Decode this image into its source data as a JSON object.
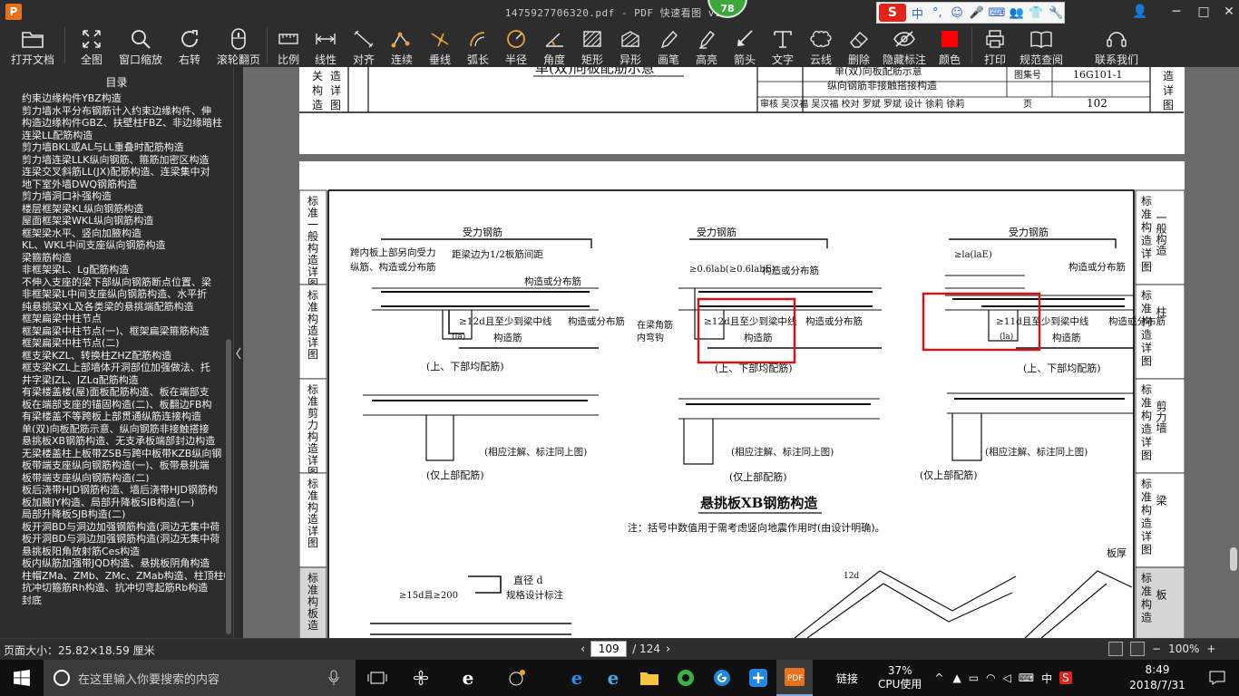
{
  "window": {
    "title": "1475927706320.pdf - PDF 快速看图 v1.9",
    "app_logo": "P",
    "badge": "78",
    "ime": {
      "logo": "S",
      "items": [
        "中",
        "°,",
        "☺",
        "🎤",
        "⌨",
        "👥",
        "👕",
        "🔧"
      ]
    },
    "controls": [
      "👤",
      "─",
      "□",
      "✕"
    ]
  },
  "toolbar": {
    "items": [
      {
        "name": "open-file",
        "label": "打开文档",
        "icon": "folder-icon"
      },
      {
        "name": "fit-all",
        "label": "全图",
        "icon": "expand-icon"
      },
      {
        "name": "window-zoom",
        "label": "窗口缩放",
        "icon": "magnifier-icon"
      },
      {
        "name": "rotate-right",
        "label": "右转",
        "icon": "rotate-icon"
      },
      {
        "name": "wheel-page",
        "label": "滚轮翻页",
        "icon": "mouse-icon"
      },
      {
        "name": "scale",
        "label": "比例",
        "icon": "ruler-icon"
      },
      {
        "name": "linear",
        "label": "线性",
        "icon": "dimension-icon"
      },
      {
        "name": "aligned",
        "label": "对齐",
        "icon": "aligned-dim-icon"
      },
      {
        "name": "continuous",
        "label": "连续",
        "icon": "polyline-icon"
      },
      {
        "name": "perpendicular",
        "label": "垂线",
        "icon": "perpendicular-icon"
      },
      {
        "name": "arc-length",
        "label": "弧长",
        "icon": "arc-icon"
      },
      {
        "name": "radius",
        "label": "半径",
        "icon": "radius-icon"
      },
      {
        "name": "angle",
        "label": "角度",
        "icon": "angle-icon"
      },
      {
        "name": "rectangle",
        "label": "矩形",
        "icon": "rect-hatch-icon"
      },
      {
        "name": "irregular",
        "label": "异形",
        "icon": "shape-hatch-icon"
      },
      {
        "name": "pen",
        "label": "画笔",
        "icon": "pen-icon"
      },
      {
        "name": "highlighter",
        "label": "高亮",
        "icon": "highlighter-icon"
      },
      {
        "name": "arrow",
        "label": "箭头",
        "icon": "arrow-icon"
      },
      {
        "name": "text",
        "label": "文字",
        "icon": "text-icon"
      },
      {
        "name": "cloud",
        "label": "云线",
        "icon": "cloud-icon"
      },
      {
        "name": "delete",
        "label": "删除",
        "icon": "eraser-icon"
      },
      {
        "name": "hide-marks",
        "label": "隐藏标注",
        "icon": "eye-hide-icon"
      },
      {
        "name": "color",
        "label": "颜色",
        "icon": "color-swatch-icon"
      },
      {
        "name": "print",
        "label": "打印",
        "icon": "printer-icon"
      },
      {
        "name": "code-lookup",
        "label": "规范查阅",
        "icon": "book-icon"
      },
      {
        "name": "contact",
        "label": "联系我们",
        "icon": "contact-icon"
      }
    ],
    "accent": "#e8a33a",
    "color_swatch": "#ff0000"
  },
  "sidebar": {
    "title": "目录",
    "items": [
      "约束边缘构件YBZ构造",
      "剪力墙水平分布钢筋计入约束边缘构件、伸",
      "构造边缘构件GBZ、扶壁柱FBZ、非边缘暗柱",
      "连梁LL配筋构造",
      "剪力墙BKL或AL与LL重叠时配筋构造",
      "剪力墙连梁LLK纵向钢筋、箍筋加密区构造",
      "连梁交叉斜筋LL(JX)配筋构造、连梁集中对",
      "地下室外墙DWQ钢筋构造",
      "剪力墙洞口补强构造",
      "楼层框架梁KL纵向钢筋构造",
      "屋面框架梁WKL纵向钢筋构造",
      "框架梁水平、竖向加腋构造",
      "KL、WKL中间支座纵向钢筋构造",
      "梁箍筋构造",
      "非框架梁L、Lg配筋构造",
      "不伸入支座的梁下部纵向钢筋断点位置、梁",
      "非框架梁L中间支座纵向钢筋构造、水平折",
      "纯悬挑梁XL及各类梁的悬挑端配筋构造",
      "框架扁梁中柱节点",
      "框架扁梁中柱节点(一)、框架扁梁箍筋构造",
      "框架扁梁中柱节点(二)",
      "框支梁KZL、转换柱ZHZ配筋构造",
      "框支梁KZL上部墙体开洞部位加强做法、托",
      "井字梁JZL、JZLg配筋构造",
      "有梁楼盖楼(屋)面板配筋构造、板在端部支",
      "板在端部支座的锚固构造(二)、板翻边FB构",
      "有梁楼盖不等跨板上部贯通纵筋连接构造",
      "单(双)向板配筋示意、纵向钢筋非接触搭接",
      "悬挑板XB钢筋构造、无支承板端部封边构造",
      "无梁楼盖柱上板带ZSB与跨中板带KZB纵向钢",
      "板带端支座纵向钢筋构造(一)、板带悬挑端",
      "板带端支座纵向钢筋构造(二)",
      "板后浇带HJD钢筋构造、墙后浇带HJD钢筋构",
      "板加腋JY构造、局部升降板SJB构造(一)",
      "局部升降板SJB构造(二)",
      "板开洞BD与洞边加强钢筋构造(洞边无集中荷",
      "板开洞BD与洞边加强钢筋构造(洞边无集中荷",
      "悬挑板阳角放射筋Ces构造",
      "板内纵筋加强带JQD构造、悬挑板阴角构造",
      "柱帽ZMa、ZMb、ZMc、ZMab构造、柱顶柱帽",
      "抗冲切箍筋Rh构造、抗冲切弯起筋Rb构造",
      "封底"
    ]
  },
  "document": {
    "top_page": {
      "left_tab": [
        "关",
        "构",
        "造"
      ],
      "left_tab2": [
        "造",
        "详",
        "图"
      ],
      "title": "单(双)向板配筋示意",
      "header_title": "单(双)向板配筋示意",
      "header_subtitle": "纵向钢筋非接触搭接构造",
      "atlas_label": "图集号",
      "atlas_no": "16G101-1",
      "page_label": "页",
      "page_no": "102",
      "review_row": "审核 吴汉福 吴汉福 校对 罗斌 罗斌 设计 徐莉 徐莉",
      "right_tab": [
        "造",
        "详",
        "图"
      ]
    },
    "main_page": {
      "left_tabs": [
        [
          "标",
          "准",
          "一",
          "般",
          "构",
          "造",
          "详",
          "图"
        ],
        [
          "标",
          "准",
          "构",
          "造",
          "详",
          "图"
        ],
        [
          "标",
          "准",
          "剪",
          "力",
          "构",
          "造",
          "详",
          "图"
        ],
        [
          "标",
          "准",
          "构",
          "造",
          "详",
          "图"
        ],
        [
          "标",
          "准",
          "构",
          "板",
          "造"
        ]
      ],
      "right_tabs": [
        {
          "text": [
            "标",
            "准",
            "构",
            "造",
            "详",
            "图"
          ],
          "side": "一般构造"
        },
        {
          "text": [
            "标",
            "准",
            "构",
            "造",
            "详",
            "图"
          ],
          "side": "柱"
        },
        {
          "text": [
            "标",
            "准",
            "构",
            "造",
            "详",
            "图"
          ],
          "side": "剪力墙"
        },
        {
          "text": [
            "标",
            "准",
            "构",
            "造",
            "详",
            "图"
          ],
          "side": "梁"
        },
        {
          "text": [
            "标",
            "准",
            "构",
            "造"
          ],
          "side": "板"
        }
      ],
      "labels": {
        "stressed_bar": "受力钢筋",
        "note_span": "跨内板上部另向受力",
        "note_span2": "纵筋、构造或分布筋",
        "half_spacing": "距梁边为1/2板筋间距",
        "dist_bar": "构造或分布筋",
        "anchor_12d": "≥12d且至少到梁中线",
        "la": "(la)",
        "construct_bar": "构造筋",
        "dist_bar2": "构造或分布筋",
        "both_bars": "(上、下部均配筋)",
        "dim_06": "≥0.6lab(≥0.6labE)",
        "corner": "在梁角筋",
        "inner_hook": "内弯钩",
        "dim_la": "≥la(laE)",
        "anchor_11d": "≥11d且至少到梁中线",
        "same_notes": "(相应注解、标注同上图)",
        "top_only": "(仅上部配筋)",
        "section_title": "悬挑板XB钢筋构造",
        "note": "注：括号中数值用于需考虑竖向地震作用时(由设计明确)。",
        "dim_15d": "≥15d且≥200",
        "diameter": "直径 d",
        "diameter_note": "规格设计标注",
        "slab_thickness": "板厚",
        "dim_12d": "12d"
      }
    }
  },
  "status": {
    "page_size": "页面大小：25.82×18.59 厘米",
    "current_page": "109",
    "total_pages": "/ 124",
    "zoom": "100%"
  },
  "taskbar": {
    "search_placeholder": "在这里输入你要搜索的内容",
    "cpu_percent": "37%",
    "cpu_label": "CPU使用",
    "link_label": "链接",
    "ime": "中",
    "time": "8:49",
    "date": "2018/7/31"
  }
}
